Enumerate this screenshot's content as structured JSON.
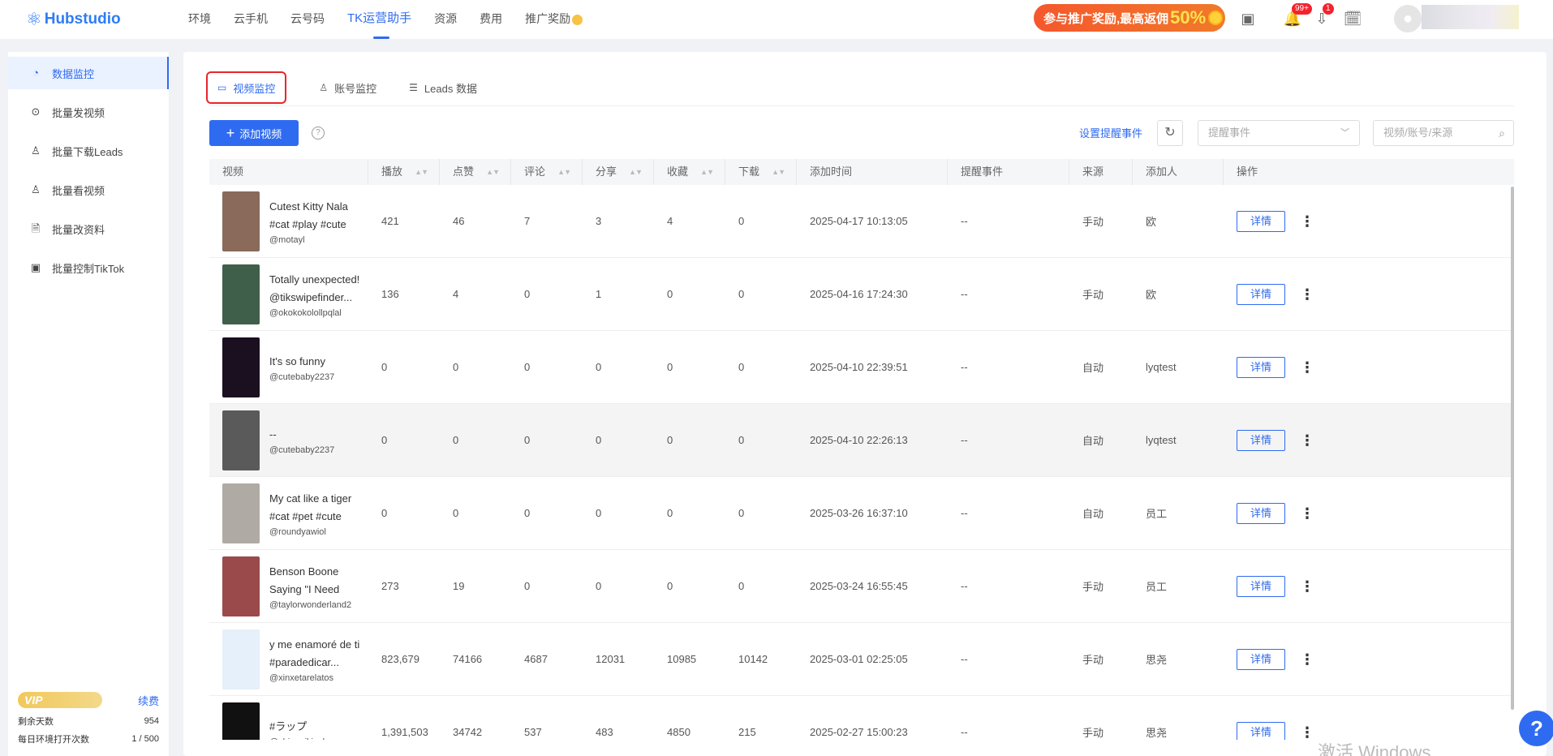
{
  "topbar": {
    "brand": "Hubstudio",
    "nav": [
      "环境",
      "云手机",
      "云号码",
      "TK运营助手",
      "资源",
      "费用",
      "推广奖励"
    ],
    "promo_text": "参与推广奖励,最高返佣",
    "promo_percent": "50%",
    "notif_badge": "99+",
    "download_badge": "1"
  },
  "sidebar": {
    "items": [
      "数据监控",
      "批量发视频",
      "批量下载Leads",
      "批量看视频",
      "批量改资料",
      "批量控制TikTok"
    ],
    "vip_label": "VIP",
    "renew": "续费",
    "remain_days_label": "剩余天数",
    "remain_days": "954",
    "daily_open_label": "每日环境打开次数",
    "daily_open": "1 / 500"
  },
  "tabs": [
    "视频监控",
    "账号监控",
    "Leads 数据"
  ],
  "toolbar": {
    "add_video": "添加视频",
    "set_alert": "设置提醒事件",
    "alert_placeholder": "提醒事件",
    "search_placeholder": "视频/账号/来源"
  },
  "table": {
    "headers": [
      "视频",
      "播放",
      "点赞",
      "评论",
      "分享",
      "收藏",
      "下载",
      "添加时间",
      "提醒事件",
      "来源",
      "添加人",
      "操作"
    ],
    "detail_label": "详情",
    "rows": [
      {
        "title": "Cutest Kitty Nala #cat #play #cute #adorabl...",
        "handle": "@motayl",
        "play": "421",
        "like": "46",
        "comment": "7",
        "share": "3",
        "fav": "4",
        "download": "0",
        "time": "2025-04-17 10:13:05",
        "alert": "--",
        "source": "手动",
        "adder": "欧",
        "thumb": "#8a6a5a"
      },
      {
        "title": "Totally unexpected! @tikswipefinder...",
        "handle": "@okokokolollpqlal",
        "play": "136",
        "like": "4",
        "comment": "0",
        "share": "1",
        "fav": "0",
        "download": "0",
        "time": "2025-04-16 17:24:30",
        "alert": "--",
        "source": "手动",
        "adder": "欧",
        "thumb": "#3f5f4a"
      },
      {
        "title": "It's so funny",
        "handle": "@cutebaby2237",
        "play": "0",
        "like": "0",
        "comment": "0",
        "share": "0",
        "fav": "0",
        "download": "0",
        "time": "2025-04-10 22:39:51",
        "alert": "--",
        "source": "自动",
        "adder": "lyqtest",
        "thumb": "#1a1020"
      },
      {
        "title": "--",
        "handle": "@cutebaby2237",
        "play": "0",
        "like": "0",
        "comment": "0",
        "share": "0",
        "fav": "0",
        "download": "0",
        "time": "2025-04-10 22:26:13",
        "alert": "--",
        "source": "自动",
        "adder": "lyqtest",
        "thumb": "#5a5a5a"
      },
      {
        "title": "My cat like a tiger #cat #pet #cute",
        "handle": "@roundyawiol",
        "play": "0",
        "like": "0",
        "comment": "0",
        "share": "0",
        "fav": "0",
        "download": "0",
        "time": "2025-03-26 16:37:10",
        "alert": "--",
        "source": "自动",
        "adder": "员工",
        "thumb": "#b0aaa4"
      },
      {
        "title": "Benson Boone Saying \"I Need Taylor Swift\"...",
        "handle": "@taylorwonderland2",
        "play": "273",
        "like": "19",
        "comment": "0",
        "share": "0",
        "fav": "0",
        "download": "0",
        "time": "2025-03-24 16:55:45",
        "alert": "--",
        "source": "手动",
        "adder": "员工",
        "thumb": "#9a4a4a"
      },
      {
        "title": "y me enamoré de ti #paradedicar...",
        "handle": "@xinxetarelatos",
        "play": "823,679",
        "like": "74166",
        "comment": "4687",
        "share": "12031",
        "fav": "10985",
        "download": "10142",
        "time": "2025-03-01 02:25:05",
        "alert": "--",
        "source": "手动",
        "adder": "思尧",
        "thumb": "#e6f0fa"
      },
      {
        "title": "#ラップ",
        "handle": "@shigunikisabu",
        "play": "1,391,503",
        "like": "34742",
        "comment": "537",
        "share": "483",
        "fav": "4850",
        "download": "215",
        "time": "2025-02-27 15:00:23",
        "alert": "--",
        "source": "手动",
        "adder": "思尧",
        "thumb": "#111111"
      }
    ]
  },
  "watermark": "激活 Windows",
  "colors": {
    "primary": "#2f6bf0",
    "highlight": "#e8262a"
  }
}
